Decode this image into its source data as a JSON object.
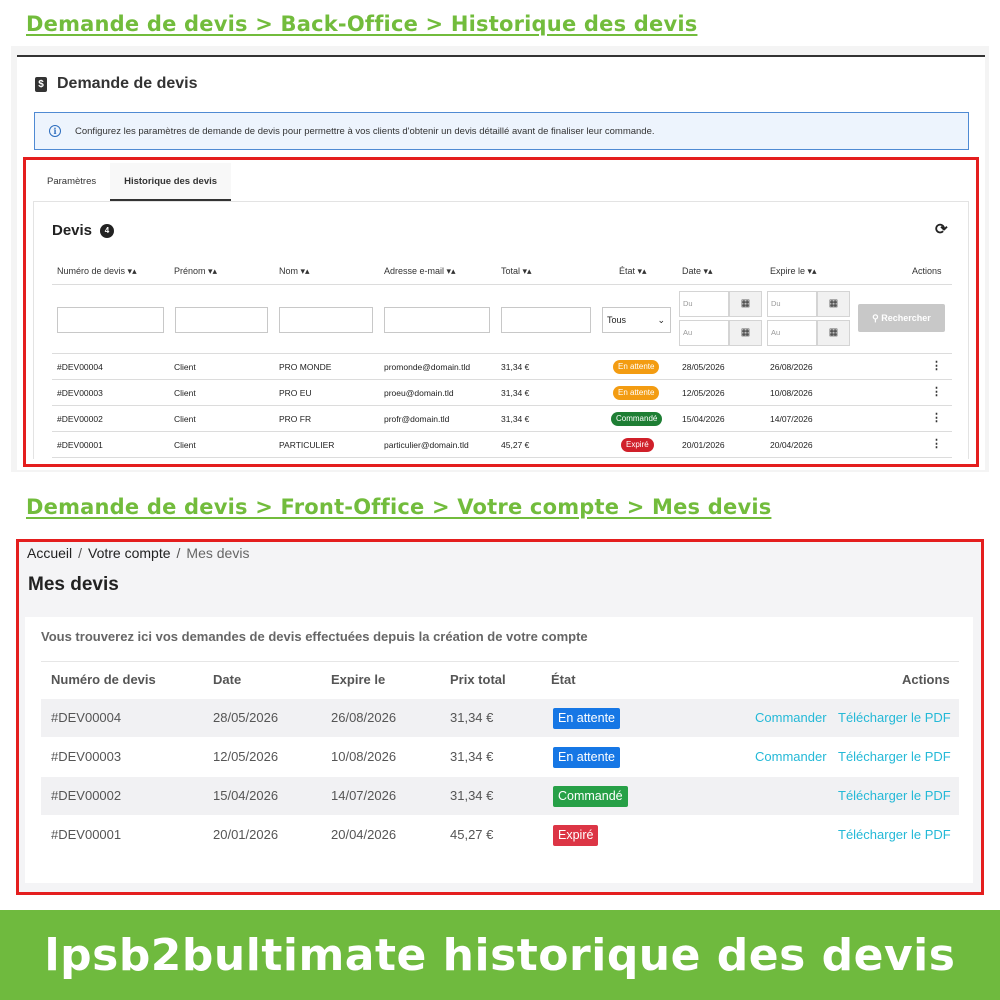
{
  "headings": {
    "back_office": "Demande de devis > Back-Office > Historique des devis",
    "front_office": "Demande de devis > Front-Office > Votre compte > Mes devis"
  },
  "back_office": {
    "title": "Demande de devis",
    "alert": "Configurez les paramètres de demande de devis pour permettre à vos clients d'obtenir un devis détaillé avant de finaliser leur commande.",
    "tabs": [
      "Paramètres",
      "Historique des devis"
    ],
    "list_title": "Devis",
    "count": "4",
    "columns": [
      "Numéro de devis",
      "Prénom",
      "Nom",
      "Adresse e-mail",
      "Total",
      "État",
      "Date",
      "Expire le",
      "Actions"
    ],
    "filters": {
      "state_select": "Tous",
      "date_from_placeholder": "Du",
      "date_to_placeholder": "Au",
      "expire_from_placeholder": "Du",
      "expire_to_placeholder": "Au",
      "search_button": "Rechercher"
    },
    "rows": [
      {
        "number": "#DEV00004",
        "first": "Client",
        "last": "PRO MONDE",
        "email": "promonde@domain.tld",
        "total": "31,34 €",
        "state": "En attente",
        "state_color": "#f39c12",
        "date": "28/05/2026",
        "expire": "26/08/2026"
      },
      {
        "number": "#DEV00003",
        "first": "Client",
        "last": "PRO EU",
        "email": "proeu@domain.tld",
        "total": "31,34 €",
        "state": "En attente",
        "state_color": "#f39c12",
        "date": "12/05/2026",
        "expire": "10/08/2026"
      },
      {
        "number": "#DEV00002",
        "first": "Client",
        "last": "PRO FR",
        "email": "profr@domain.tld",
        "total": "31,34 €",
        "state": "Commandé",
        "state_color": "#1e7e34",
        "date": "15/04/2026",
        "expire": "14/07/2026"
      },
      {
        "number": "#DEV00001",
        "first": "Client",
        "last": "PARTICULIER",
        "email": "particulier@domain.tld",
        "total": "45,27 €",
        "state": "Expiré",
        "state_color": "#d0202a",
        "date": "20/01/2026",
        "expire": "20/04/2026"
      }
    ]
  },
  "front_office": {
    "breadcrumb": [
      "Accueil",
      "Votre compte",
      "Mes devis"
    ],
    "title": "Mes devis",
    "intro": "Vous trouverez ici vos demandes de devis effectuées depuis la création de votre compte",
    "columns": [
      "Numéro de devis",
      "Date",
      "Expire le",
      "Prix total",
      "État",
      "Actions"
    ],
    "order_link": "Commander",
    "pdf_link": "Télécharger le PDF",
    "rows": [
      {
        "number": "#DEV00004",
        "date": "28/05/2026",
        "expire": "26/08/2026",
        "total": "31,34 €",
        "state": "En attente",
        "state_color": "#1677e5",
        "can_order": true
      },
      {
        "number": "#DEV00003",
        "date": "12/05/2026",
        "expire": "10/08/2026",
        "total": "31,34 €",
        "state": "En attente",
        "state_color": "#1677e5",
        "can_order": true
      },
      {
        "number": "#DEV00002",
        "date": "15/04/2026",
        "expire": "14/07/2026",
        "total": "31,34 €",
        "state": "Commandé",
        "state_color": "#27a047",
        "can_order": false
      },
      {
        "number": "#DEV00001",
        "date": "20/01/2026",
        "expire": "20/04/2026",
        "total": "45,27 €",
        "state": "Expiré",
        "state_color": "#dc3545",
        "can_order": false
      }
    ]
  },
  "banner": "lpsb2bultimate historique des devis",
  "colors": {
    "heading_green": "#72bc3c",
    "banner_green": "#6fba3e",
    "frame_red": "#e41e1e",
    "link_cyan": "#24b9d7"
  }
}
